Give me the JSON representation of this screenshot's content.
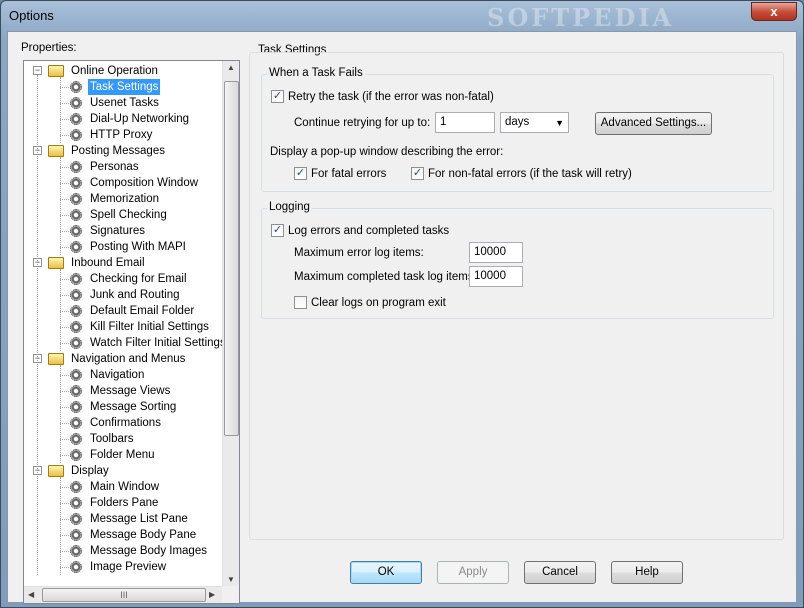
{
  "window": {
    "title": "Options",
    "watermark": "SOFTPEDIA",
    "close_glyph": "x"
  },
  "properties_label": "Properties:",
  "tree": [
    {
      "label": "Online Operation",
      "type": "folder",
      "level": 0
    },
    {
      "label": "Task Settings",
      "type": "item",
      "level": 1,
      "selected": true
    },
    {
      "label": "Usenet Tasks",
      "type": "item",
      "level": 1
    },
    {
      "label": "Dial-Up Networking",
      "type": "item",
      "level": 1
    },
    {
      "label": "HTTP Proxy",
      "type": "item",
      "level": 1
    },
    {
      "label": "Posting Messages",
      "type": "folder",
      "level": 0
    },
    {
      "label": "Personas",
      "type": "item",
      "level": 1
    },
    {
      "label": "Composition Window",
      "type": "item",
      "level": 1
    },
    {
      "label": "Memorization",
      "type": "item",
      "level": 1
    },
    {
      "label": "Spell Checking",
      "type": "item",
      "level": 1
    },
    {
      "label": "Signatures",
      "type": "item",
      "level": 1
    },
    {
      "label": "Posting With MAPI",
      "type": "item",
      "level": 1
    },
    {
      "label": "Inbound Email",
      "type": "folder",
      "level": 0
    },
    {
      "label": "Checking for Email",
      "type": "item",
      "level": 1
    },
    {
      "label": "Junk and Routing",
      "type": "item",
      "level": 1
    },
    {
      "label": "Default Email Folder",
      "type": "item",
      "level": 1
    },
    {
      "label": "Kill Filter Initial Settings",
      "type": "item",
      "level": 1
    },
    {
      "label": "Watch Filter Initial Settings",
      "type": "item",
      "level": 1
    },
    {
      "label": "Navigation and Menus",
      "type": "folder",
      "level": 0
    },
    {
      "label": "Navigation",
      "type": "item",
      "level": 1
    },
    {
      "label": "Message Views",
      "type": "item",
      "level": 1
    },
    {
      "label": "Message Sorting",
      "type": "item",
      "level": 1
    },
    {
      "label": "Confirmations",
      "type": "item",
      "level": 1
    },
    {
      "label": "Toolbars",
      "type": "item",
      "level": 1
    },
    {
      "label": "Folder Menu",
      "type": "item",
      "level": 1
    },
    {
      "label": "Display",
      "type": "folder",
      "level": 0
    },
    {
      "label": "Main Window",
      "type": "item",
      "level": 1
    },
    {
      "label": "Folders Pane",
      "type": "item",
      "level": 1
    },
    {
      "label": "Message List Pane",
      "type": "item",
      "level": 1
    },
    {
      "label": "Message Body Pane",
      "type": "item",
      "level": 1
    },
    {
      "label": "Message Body Images",
      "type": "item",
      "level": 1
    },
    {
      "label": "Image Preview",
      "type": "item",
      "level": 1
    }
  ],
  "scroll_glyphs": {
    "up": "▲",
    "down": "▼",
    "left": "◀",
    "right": "▶",
    "grip": "III",
    "expander_minus": "−"
  },
  "task_settings": {
    "title": "Task Settings",
    "when_fails": {
      "title": "When a Task Fails",
      "retry_label": "Retry the task (if the error was non-fatal)",
      "retry_checked": true,
      "continue_label": "Continue retrying for up to:",
      "continue_value": "1",
      "unit_value": "days",
      "advanced_button": "Advanced Settings...",
      "popup_label": "Display a pop-up window describing the error:",
      "fatal_label": "For fatal errors",
      "fatal_checked": true,
      "nonfatal_label": "For non-fatal errors (if the task will retry)",
      "nonfatal_checked": true
    },
    "logging": {
      "title": "Logging",
      "log_label": "Log errors and completed tasks",
      "log_checked": true,
      "max_error_label": "Maximum error log items:",
      "max_error_value": "10000",
      "max_completed_label": "Maximum completed task log items:",
      "max_completed_value": "10000",
      "clear_label": "Clear logs on program exit",
      "clear_checked": false
    }
  },
  "check_glyph": "✓",
  "buttons": {
    "ok": "OK",
    "apply": "Apply",
    "cancel": "Cancel",
    "help": "Help"
  }
}
